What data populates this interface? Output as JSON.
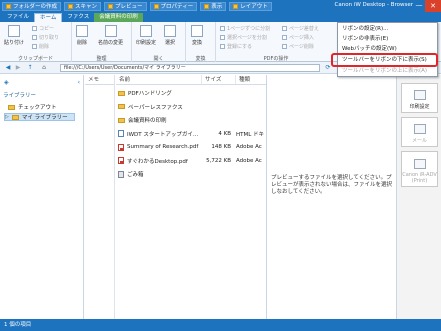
{
  "window": {
    "title": "Canon iW Desktop - Browser",
    "minimize": "—",
    "close": "✕"
  },
  "qat": {
    "items": [
      "フォルダーの作成",
      "スキャン",
      "プレビュー",
      "プロパティー",
      "表示",
      "レイアウト"
    ]
  },
  "tabs": [
    "ファイル",
    "ホーム",
    "ファクス",
    "会議資料の印刷"
  ],
  "ribbon": {
    "clipboard": {
      "paste": "貼り付け",
      "copy": "コピー",
      "cut": "切り取り",
      "delete_s": "削除",
      "label": "クリップボード"
    },
    "organize": {
      "delete": "削除",
      "rename": "名前の変更",
      "label": "整理"
    },
    "open": {
      "print_settings": "印刷設定",
      "browse": "選択",
      "label": "開く"
    },
    "convert": {
      "convert": "変換",
      "label": "変換"
    },
    "pdf": {
      "items": [
        "1ページずつに分割",
        "選択ページを分割",
        "登録にする",
        "ページ差替え",
        "ページ挿入",
        "ページ削除"
      ],
      "label": "PDFの操作"
    }
  },
  "address": {
    "path": "file:///C:/Users/User/Documents/マイ ライブラリー"
  },
  "left": {
    "header": "ライブラリー",
    "items": [
      "チェックアウト",
      "マイ ライブラリー"
    ]
  },
  "memo": {
    "header": "メモ"
  },
  "files": {
    "headers": [
      "名前",
      "サイズ",
      "種類"
    ],
    "rows": [
      {
        "name": "PDFハンドリング",
        "size": "",
        "type": "",
        "icon": "folder"
      },
      {
        "name": "ペーパーレスファクス",
        "size": "",
        "type": "",
        "icon": "folder"
      },
      {
        "name": "会議資料の印刷",
        "size": "",
        "type": "",
        "icon": "folder"
      },
      {
        "name": "IWDT スタートアップガイ…",
        "size": "4 KB",
        "type": "HTML ドキ",
        "icon": "doc"
      },
      {
        "name": "Summary of Research.pdf",
        "size": "148 KB",
        "type": "Adobe Ac",
        "icon": "pdf"
      },
      {
        "name": "すぐわかるDesktop.pdf",
        "size": "5,722 KB",
        "type": "Adobe Ac",
        "icon": "pdf"
      },
      {
        "name": "ごみ箱",
        "size": "",
        "type": "",
        "icon": "trash"
      }
    ]
  },
  "preview": {
    "message": "プレビューするファイルを選択してください。プレビューが表示されない場合は、ファイルを選択しなおしてください。"
  },
  "right": {
    "buttons": [
      "印刷設定",
      "メール",
      "Canon iR-ADV (Print)"
    ]
  },
  "menu": {
    "items": [
      "リボンの設定(R)...",
      "リボンの非表示(E)",
      "Webバッチの設定(W)",
      "ツールバーをリボンの下に表示(S)",
      "ツールバーをリボンの上に表示(A)"
    ]
  },
  "status": {
    "text": "1 個の項目"
  }
}
